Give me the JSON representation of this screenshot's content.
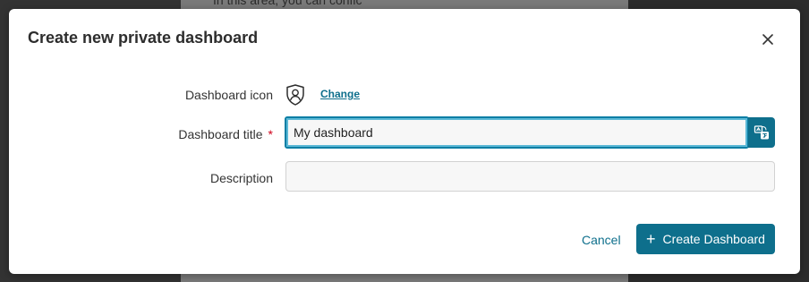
{
  "background": {
    "partial_text": "In this area, you can confic"
  },
  "dialog": {
    "title": "Create new private dashboard",
    "close_icon": "close-icon",
    "fields": {
      "icon": {
        "label": "Dashboard icon",
        "icon": "user-shield-icon",
        "change_link": "Change"
      },
      "title": {
        "label": "Dashboard title",
        "required_marker": "*",
        "value": "My dashboard",
        "translate_icon": "translate-icon"
      },
      "description": {
        "label": "Description",
        "value": ""
      }
    },
    "actions": {
      "cancel": "Cancel",
      "create": "Create Dashboard",
      "create_icon": "+"
    }
  },
  "colors": {
    "accent": "#0e6f8c",
    "focus_ring": "#5bb8d6",
    "required": "#d0021b"
  }
}
